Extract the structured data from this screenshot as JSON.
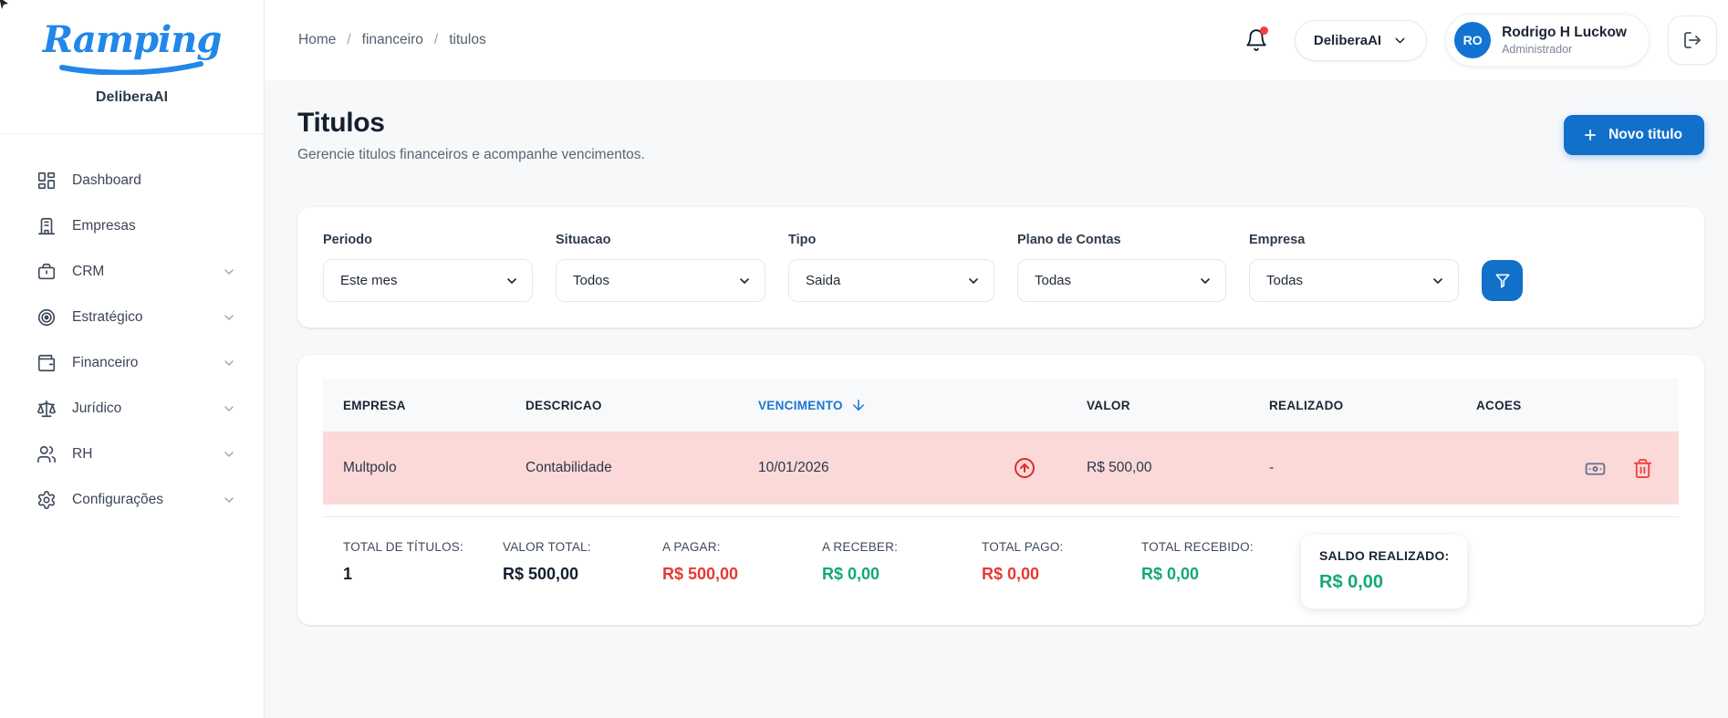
{
  "colors": {
    "primary_blue": "#1170ca",
    "logo_blue": "#2287e8",
    "sort_link_blue": "#1976d2",
    "row_pink": "#fbd9d9",
    "negative_red": "#e53935",
    "positive_green": "#12a877",
    "trash_red": "#ef4444"
  },
  "sidebar": {
    "logo_text": "Ramping",
    "workspace": "DeliberaAI",
    "items": [
      {
        "label": "Dashboard",
        "icon": "dashboard-icon",
        "has_submenu": false
      },
      {
        "label": "Empresas",
        "icon": "building-icon",
        "has_submenu": false
      },
      {
        "label": "CRM",
        "icon": "briefcase-icon",
        "has_submenu": true
      },
      {
        "label": "Estratégico",
        "icon": "target-icon",
        "has_submenu": true
      },
      {
        "label": "Financeiro",
        "icon": "wallet-icon",
        "has_submenu": true
      },
      {
        "label": "Jurídico",
        "icon": "scales-icon",
        "has_submenu": true
      },
      {
        "label": "RH",
        "icon": "users-icon",
        "has_submenu": true
      },
      {
        "label": "Configurações",
        "icon": "gear-icon",
        "has_submenu": true
      }
    ]
  },
  "topbar": {
    "breadcrumb": {
      "items": [
        "Home",
        "financeiro",
        "titulos"
      ],
      "separator": "/"
    },
    "workspace_selector": {
      "label": "DeliberaAI"
    },
    "user": {
      "initials": "RO",
      "name": "Rodrigo H Luckow",
      "role": "Administrador"
    }
  },
  "page": {
    "title": "Titulos",
    "subtitle": "Gerencie titulos financeiros e acompanhe vencimentos.",
    "new_button_plus": "+",
    "new_button_label": "Novo titulo"
  },
  "filters": {
    "fields": [
      {
        "label": "Periodo",
        "value": "Este mes"
      },
      {
        "label": "Situacao",
        "value": "Todos"
      },
      {
        "label": "Tipo",
        "value": "Saida"
      },
      {
        "label": "Plano de Contas",
        "value": "Todas"
      },
      {
        "label": "Empresa",
        "value": "Todas"
      }
    ]
  },
  "table": {
    "columns": [
      "EMPRESA",
      "DESCRICAO",
      "VENCIMENTO",
      "VALOR",
      "REALIZADO",
      "ACOES"
    ],
    "sorted_column": "VENCIMENTO",
    "sort_direction": "desc",
    "rows": [
      {
        "empresa": "Multpolo",
        "descricao": "Contabilidade",
        "vencimento": "10/01/2026",
        "tipo": "saida",
        "valor": "R$ 500,00",
        "realizado": "-"
      }
    ]
  },
  "summary": {
    "items": [
      {
        "label": "TOTAL DE TÍTULOS:",
        "value": "1",
        "color": "dark"
      },
      {
        "label": "VALOR TOTAL:",
        "value": "R$ 500,00",
        "color": "dark"
      },
      {
        "label": "A PAGAR:",
        "value": "R$ 500,00",
        "color": "red"
      },
      {
        "label": "A RECEBER:",
        "value": "R$ 0,00",
        "color": "green"
      },
      {
        "label": "TOTAL PAGO:",
        "value": "R$ 0,00",
        "color": "red"
      },
      {
        "label": "TOTAL RECEBIDO:",
        "value": "R$ 0,00",
        "color": "green"
      }
    ],
    "highlight": {
      "label": "SALDO REALIZADO:",
      "value": "R$ 0,00",
      "color": "green"
    }
  }
}
